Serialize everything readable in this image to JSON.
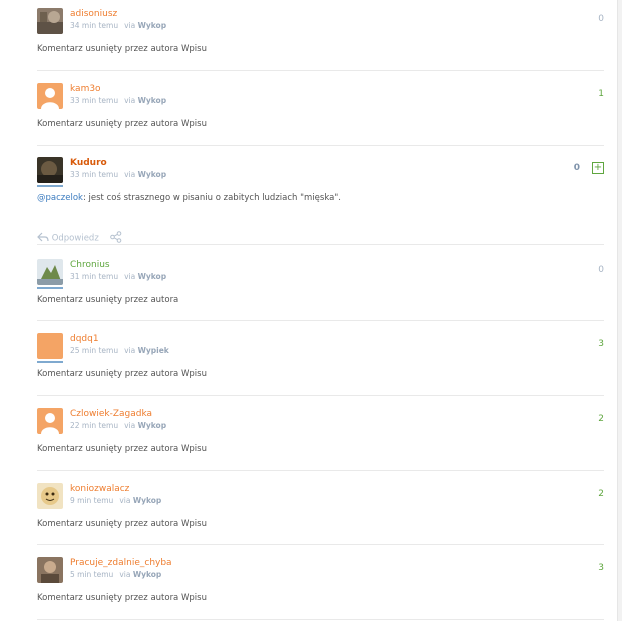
{
  "comments": [
    {
      "username": "adisoniusz",
      "time": "34 min temu",
      "via": "via",
      "source": "Wykop",
      "votes": "0",
      "body": "Komentarz usunięty przez autora Wpisu"
    },
    {
      "username": "kam3o",
      "time": "33 min temu",
      "via": "via",
      "source": "Wykop",
      "votes": "1",
      "body": "Komentarz usunięty przez autora Wpisu"
    },
    {
      "username": "Kuduro",
      "time": "33 min temu",
      "via": "via",
      "source": "Wykop",
      "votes": "0",
      "vote_plus": "+",
      "mention": "@paczelok",
      "body_text": ": jest coś strasznego w pisaniu o zabitych ludziach \"mięska\".",
      "reply_label": "Odpowiedz"
    },
    {
      "username": "Chronius",
      "time": "31 min temu",
      "via": "via",
      "source": "Wykop",
      "votes": "0",
      "body": "Komentarz usunięty przez autora"
    },
    {
      "username": "dqdq1",
      "time": "25 min temu",
      "via": "via",
      "source": "Wypiek",
      "votes": "3",
      "body": "Komentarz usunięty przez autora Wpisu"
    },
    {
      "username": "Czlowiek-Zagadka",
      "time": "22 min temu",
      "via": "via",
      "source": "Wykop",
      "votes": "2",
      "body": "Komentarz usunięty przez autora Wpisu"
    },
    {
      "username": "koniozwalacz",
      "time": "9 min temu",
      "via": "via",
      "source": "Wykop",
      "votes": "2",
      "body": "Komentarz usunięty przez autora Wpisu"
    },
    {
      "username": "Pracuje_zdalnie_chyba",
      "time": "5 min temu",
      "via": "via",
      "source": "Wykop",
      "votes": "3",
      "body": "Komentarz usunięty przez autora Wpisu"
    }
  ],
  "colors": {
    "orange": "#ee7d2f",
    "green": "#5fa63f",
    "meta": "#a7b4c4",
    "link": "#3b7bbf"
  },
  "icons": {
    "reply": "reply-arrow-icon",
    "share": "share-icon",
    "default_avatar": "user-silhouette-icon"
  }
}
